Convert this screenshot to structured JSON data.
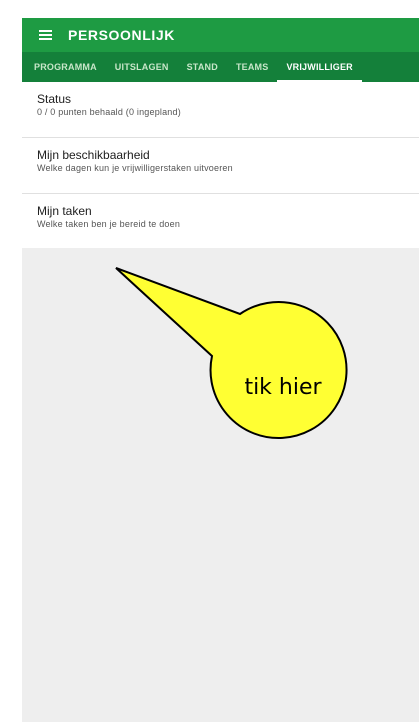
{
  "appbar": {
    "title": "PERSOONLIJK",
    "menu_icon": "hamburger-icon"
  },
  "tabs": [
    {
      "label": "PROGRAMMA",
      "active": false
    },
    {
      "label": "UITSLAGEN",
      "active": false
    },
    {
      "label": "STAND",
      "active": false
    },
    {
      "label": "TEAMS",
      "active": false
    },
    {
      "label": "VRIJWILLIGER",
      "active": true
    }
  ],
  "items": [
    {
      "title": "Status",
      "subtitle": "0 / 0 punten behaald (0 ingepland)"
    },
    {
      "title": "Mijn beschikbaarheid",
      "subtitle": "Welke dagen kun je vrijwilligerstaken uitvoeren"
    },
    {
      "title": "Mijn taken",
      "subtitle": "Welke taken ben je bereid te doen"
    }
  ],
  "callout": {
    "text": "tik hier",
    "fill": "#ffff33"
  },
  "colors": {
    "appbar": "#1e9b43",
    "tabbar": "#14803a",
    "background": "#eeeeee"
  }
}
